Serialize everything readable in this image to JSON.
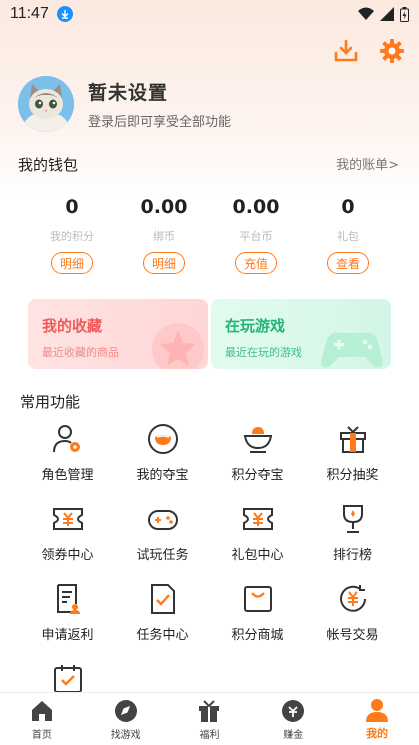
{
  "status": {
    "time": "11:47"
  },
  "profile": {
    "name": "暂未设置",
    "hint": "登录后即可享受全部功能"
  },
  "wallet": {
    "title": "我的钱包",
    "link": "我的账单>",
    "items": [
      {
        "value": "0",
        "label": "我的积分",
        "button": "明细"
      },
      {
        "value": "0.00",
        "label": "绑币",
        "button": "明细"
      },
      {
        "value": "0.00",
        "label": "平台币",
        "button": "充值"
      },
      {
        "value": "0",
        "label": "礼包",
        "button": "查看"
      }
    ]
  },
  "cards": {
    "favorites": {
      "title": "我的收藏",
      "subtitle": "最近收藏的商品"
    },
    "playing": {
      "title": "在玩游戏",
      "subtitle": "最近在玩的游戏"
    }
  },
  "functions": {
    "title": "常用功能",
    "items": [
      {
        "label": "角色管理",
        "icon": "role-manage-icon"
      },
      {
        "label": "我的夺宝",
        "icon": "my-treasure-icon"
      },
      {
        "label": "积分夺宝",
        "icon": "points-treasure-icon"
      },
      {
        "label": "积分抽奖",
        "icon": "points-lottery-icon"
      },
      {
        "label": "领券中心",
        "icon": "coupon-center-icon"
      },
      {
        "label": "试玩任务",
        "icon": "trial-task-icon"
      },
      {
        "label": "礼包中心",
        "icon": "gift-center-icon"
      },
      {
        "label": "排行榜",
        "icon": "ranking-icon"
      },
      {
        "label": "申请返利",
        "icon": "rebate-icon"
      },
      {
        "label": "任务中心",
        "icon": "task-center-icon"
      },
      {
        "label": "积分商城",
        "icon": "points-mall-icon"
      },
      {
        "label": "帐号交易",
        "icon": "account-trade-icon"
      },
      {
        "label": "",
        "icon": "checkin-icon"
      }
    ]
  },
  "tabs": [
    {
      "label": "首页",
      "icon": "home-icon"
    },
    {
      "label": "找游戏",
      "icon": "compass-icon"
    },
    {
      "label": "福利",
      "icon": "gift-icon"
    },
    {
      "label": "赚金",
      "icon": "money-bag-icon"
    },
    {
      "label": "我的",
      "icon": "user-icon"
    }
  ],
  "colors": {
    "accent": "#ff7a1a",
    "favorite": "#f05a5a",
    "playing": "#22b573"
  }
}
